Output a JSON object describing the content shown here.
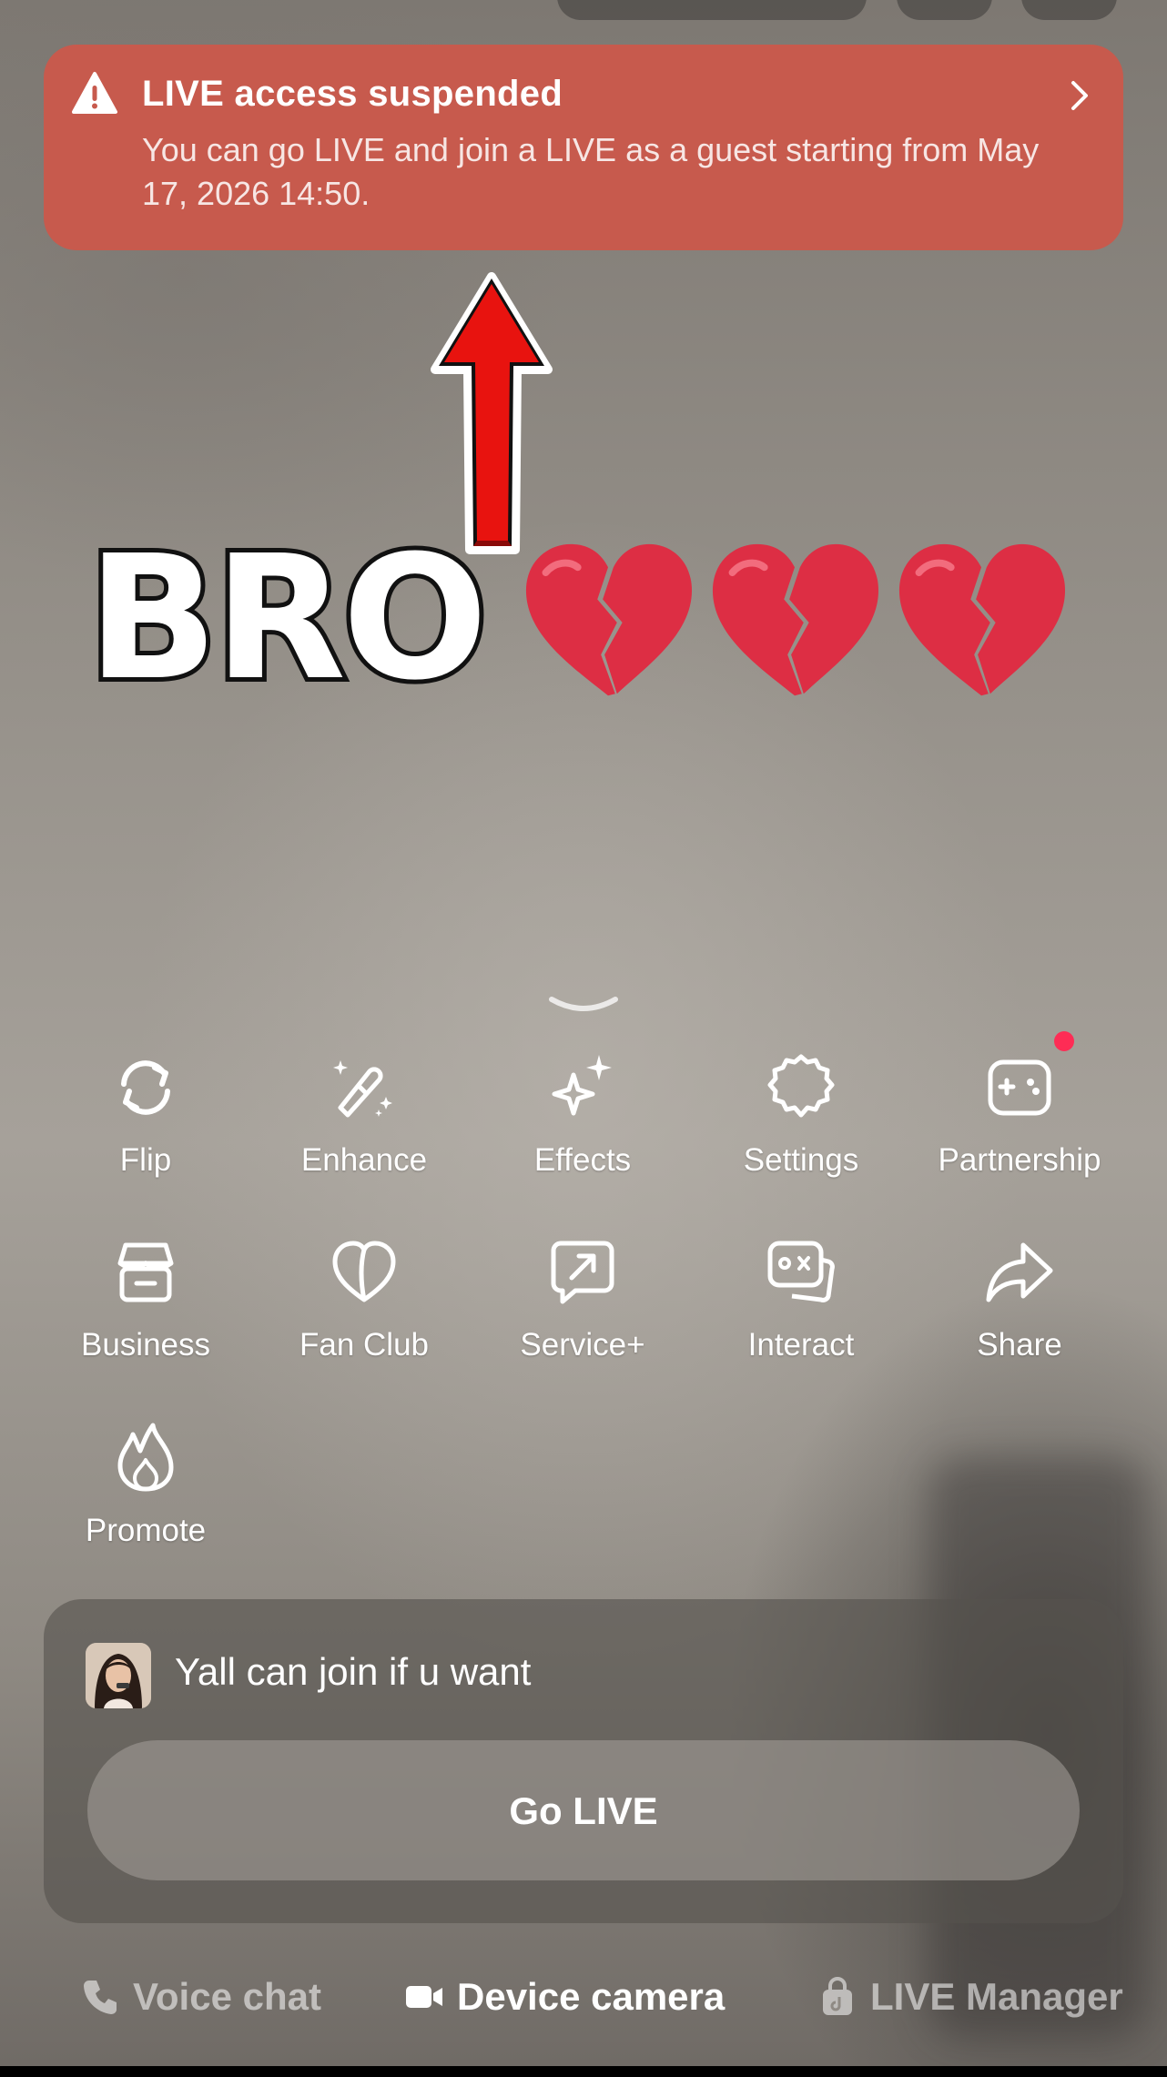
{
  "banner": {
    "title": "LIVE access suspended",
    "body": "You can go LIVE and join a LIVE as a guest starting from May 17, 2026 14:50.",
    "icon": "warning-triangle-icon",
    "color": "#c75a4d"
  },
  "overlay": {
    "sticker_text": "BRO",
    "emoji": [
      "💔",
      "💔",
      "💔"
    ]
  },
  "tools": [
    {
      "label": "Flip",
      "icon": "flip-camera-icon"
    },
    {
      "label": "Enhance",
      "icon": "magic-wand-icon"
    },
    {
      "label": "Effects",
      "icon": "sparkles-icon"
    },
    {
      "label": "Settings",
      "icon": "gear-icon"
    },
    {
      "label": "Partnership",
      "icon": "gamepad-icon",
      "badge": true
    },
    {
      "label": "Business",
      "icon": "storefront-icon"
    },
    {
      "label": "Fan Club",
      "icon": "heart-icon"
    },
    {
      "label": "Service+",
      "icon": "external-box-icon"
    },
    {
      "label": "Interact",
      "icon": "game-cards-icon"
    },
    {
      "label": "Share",
      "icon": "share-arrow-icon"
    },
    {
      "label": "Promote",
      "icon": "flame-icon"
    }
  ],
  "panel": {
    "caption": "Yall can join if u want",
    "go_live_label": "Go LIVE"
  },
  "modes": [
    {
      "label": "Voice chat",
      "icon": "phone-icon",
      "active": false
    },
    {
      "label": "Device camera",
      "icon": "video-camera-icon",
      "active": true
    },
    {
      "label": "LIVE Manager",
      "icon": "lock-bag-icon",
      "active": false
    }
  ],
  "colors": {
    "badge": "#fe2c55",
    "arrow": "#e8130f"
  }
}
